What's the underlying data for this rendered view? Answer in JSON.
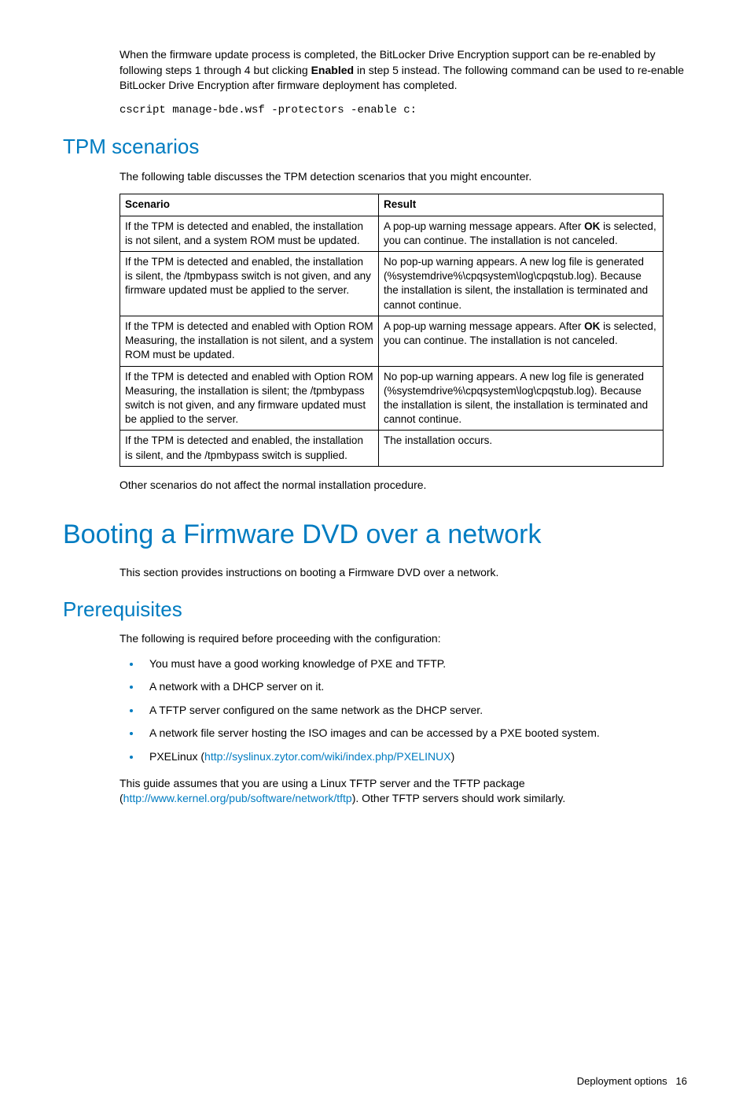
{
  "intro": {
    "p1_a": "When the firmware update process is completed, the BitLocker Drive Encryption support can be re-enabled by following steps 1 through 4 but clicking ",
    "p1_bold": "Enabled",
    "p1_b": " in step 5 instead. The following command can be used to re-enable BitLocker Drive Encryption after firmware deployment has completed.",
    "code": "cscript manage-bde.wsf -protectors -enable c:"
  },
  "tpm": {
    "heading": "TPM scenarios",
    "intro": "The following table discusses the TPM detection scenarios that you might encounter.",
    "col1": "Scenario",
    "col2": "Result",
    "rows": [
      {
        "scenario": "If the TPM is detected and enabled, the installation is not silent, and a system ROM must be updated.",
        "result_a": "A pop-up warning message appears. After ",
        "result_bold": "OK",
        "result_b": " is selected, you can continue. The installation is not canceled."
      },
      {
        "scenario": "If the TPM is detected and enabled, the installation is silent, the /tpmbypass switch is not given, and any firmware updated must be applied to the server.",
        "result": "No pop-up warning appears. A new log file is generated (%systemdrive%\\cpqsystem\\log\\cpqstub.log). Because the installation is silent, the installation is terminated and cannot continue."
      },
      {
        "scenario": "If the TPM is detected and enabled with Option ROM Measuring, the installation is not silent, and a system ROM must be updated.",
        "result_a": "A pop-up warning message appears. After ",
        "result_bold": "OK",
        "result_b": " is selected, you can continue. The installation is not canceled."
      },
      {
        "scenario": "If the TPM is detected and enabled with Option ROM Measuring, the installation is silent; the /tpmbypass switch is not given, and any firmware updated must be applied to the server.",
        "result": "No pop-up warning appears. A new log file is generated (%systemdrive%\\cpqsystem\\log\\cpqstub.log). Because the installation is silent, the installation is terminated and cannot continue."
      },
      {
        "scenario": "If the TPM is detected and enabled, the installation is silent, and the /tpmbypass switch is supplied.",
        "result": "The installation occurs."
      }
    ],
    "after": "Other scenarios do not affect the normal installation procedure."
  },
  "booting": {
    "heading": "Booting a Firmware DVD over a network",
    "intro": "This section provides instructions on booting a Firmware DVD over a network."
  },
  "prereq": {
    "heading": "Prerequisites",
    "intro": "The following is required before proceeding with the configuration:",
    "items": {
      "b1": "You must have a good working knowledge of PXE and TFTP.",
      "b2": "A network with a DHCP server on it.",
      "b3": "A TFTP server configured on the same network as the DHCP server.",
      "b4": "A network file server hosting the ISO images and can be accessed by a PXE booted system.",
      "b5_a": "PXELinux (",
      "b5_link": "http://syslinux.zytor.com/wiki/index.php/PXELINUX",
      "b5_b": ")"
    },
    "after_a": "This guide assumes that you are using a Linux TFTP server and the TFTP package (",
    "after_link": "http://www.kernel.org/pub/software/network/tftp",
    "after_b": "). Other TFTP servers should work similarly."
  },
  "footer": {
    "section": "Deployment options",
    "page": "16"
  }
}
